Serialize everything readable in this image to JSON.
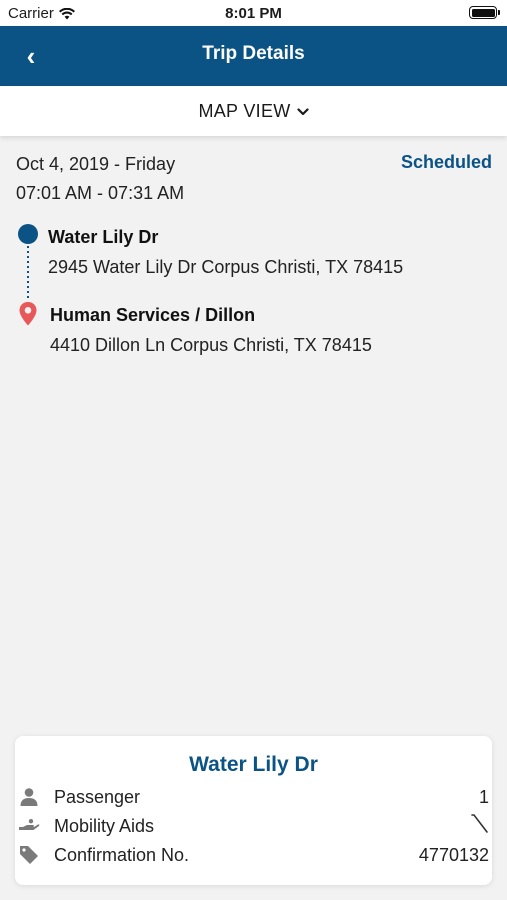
{
  "status_bar": {
    "carrier": "Carrier",
    "time": "8:01 PM",
    "wifi_icon": "wifi-icon",
    "battery_icon": "battery-full-icon"
  },
  "nav": {
    "back_icon": "chevron-left-icon",
    "back_glyph": "‹",
    "title": "Trip Details"
  },
  "map_view": {
    "label": "MAP VIEW",
    "chevron_icon": "chevron-down-icon",
    "chevron_glyph": "⌄"
  },
  "trip": {
    "date": "Oct 4, 2019 - Friday",
    "time_range": "07:01 AM - 07:31 AM",
    "status": "Scheduled",
    "pickup": {
      "name": "Water Lily Dr",
      "address": "2945 Water Lily Dr Corpus Christi, TX 78415"
    },
    "dropoff": {
      "name": "Human Services / Dillon",
      "address": "4410 Dillon Ln Corpus Christi, TX 78415"
    }
  },
  "card": {
    "title": "Water Lily Dr",
    "rows": [
      {
        "icon": "person-icon",
        "label": "Passenger",
        "value": "1"
      },
      {
        "icon": "hand-icon",
        "label": "Mobility Aids",
        "value": ""
      },
      {
        "icon": "ticket-icon",
        "label": "Confirmation No.",
        "value": "4770132"
      }
    ]
  },
  "colors": {
    "primary": "#0b5385",
    "pin": "#e8575a",
    "background": "#f2f2f2"
  }
}
